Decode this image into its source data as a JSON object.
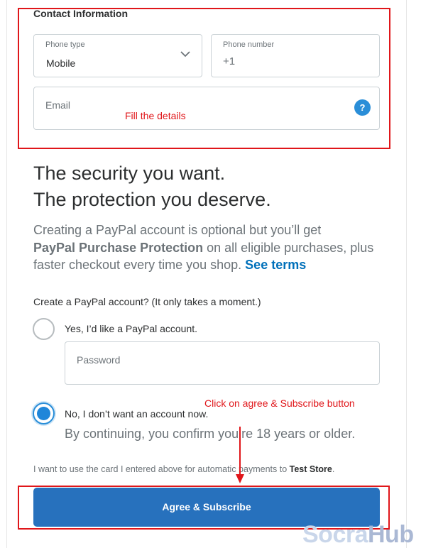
{
  "contact": {
    "title": "Contact Information",
    "phone_type": {
      "label": "Phone type",
      "value": "Mobile"
    },
    "phone_number": {
      "label": "Phone number",
      "value": "+1"
    },
    "email": {
      "placeholder": "Email",
      "help_icon": "question-circle-icon",
      "help_glyph": "?"
    }
  },
  "annotations": {
    "fill_details": "Fill the details",
    "click_agree": "Click on agree & Subscribe button",
    "color": "#e0161a"
  },
  "promo": {
    "headline_line1": "The security you want.",
    "headline_line2": "The protection you deserve.",
    "body_before": "Creating a PayPal account is optional but you’ll get",
    "body_bold": "PayPal Purchase Protection",
    "body_after": " on all eligible purchases, plus faster checkout every time you shop.",
    "link": "See terms"
  },
  "account_choice": {
    "question": "Create a PayPal account? (It only takes a moment.)",
    "yes_label": "Yes, I’d like a PayPal account.",
    "yes_selected": false,
    "password_placeholder": "Password",
    "no_label": "No, I don’t want an account now.",
    "no_selected": true,
    "age_note": "By continuing, you confirm you’re 18 years or older."
  },
  "consent": {
    "text": "I want to use the card I entered above for automatic payments to ",
    "merchant": "Test Store",
    "period": "."
  },
  "submit": {
    "label": "Agree & Subscribe",
    "color": "#2771bd"
  },
  "watermark": {
    "part1": "Socra",
    "part2": "Hub"
  }
}
